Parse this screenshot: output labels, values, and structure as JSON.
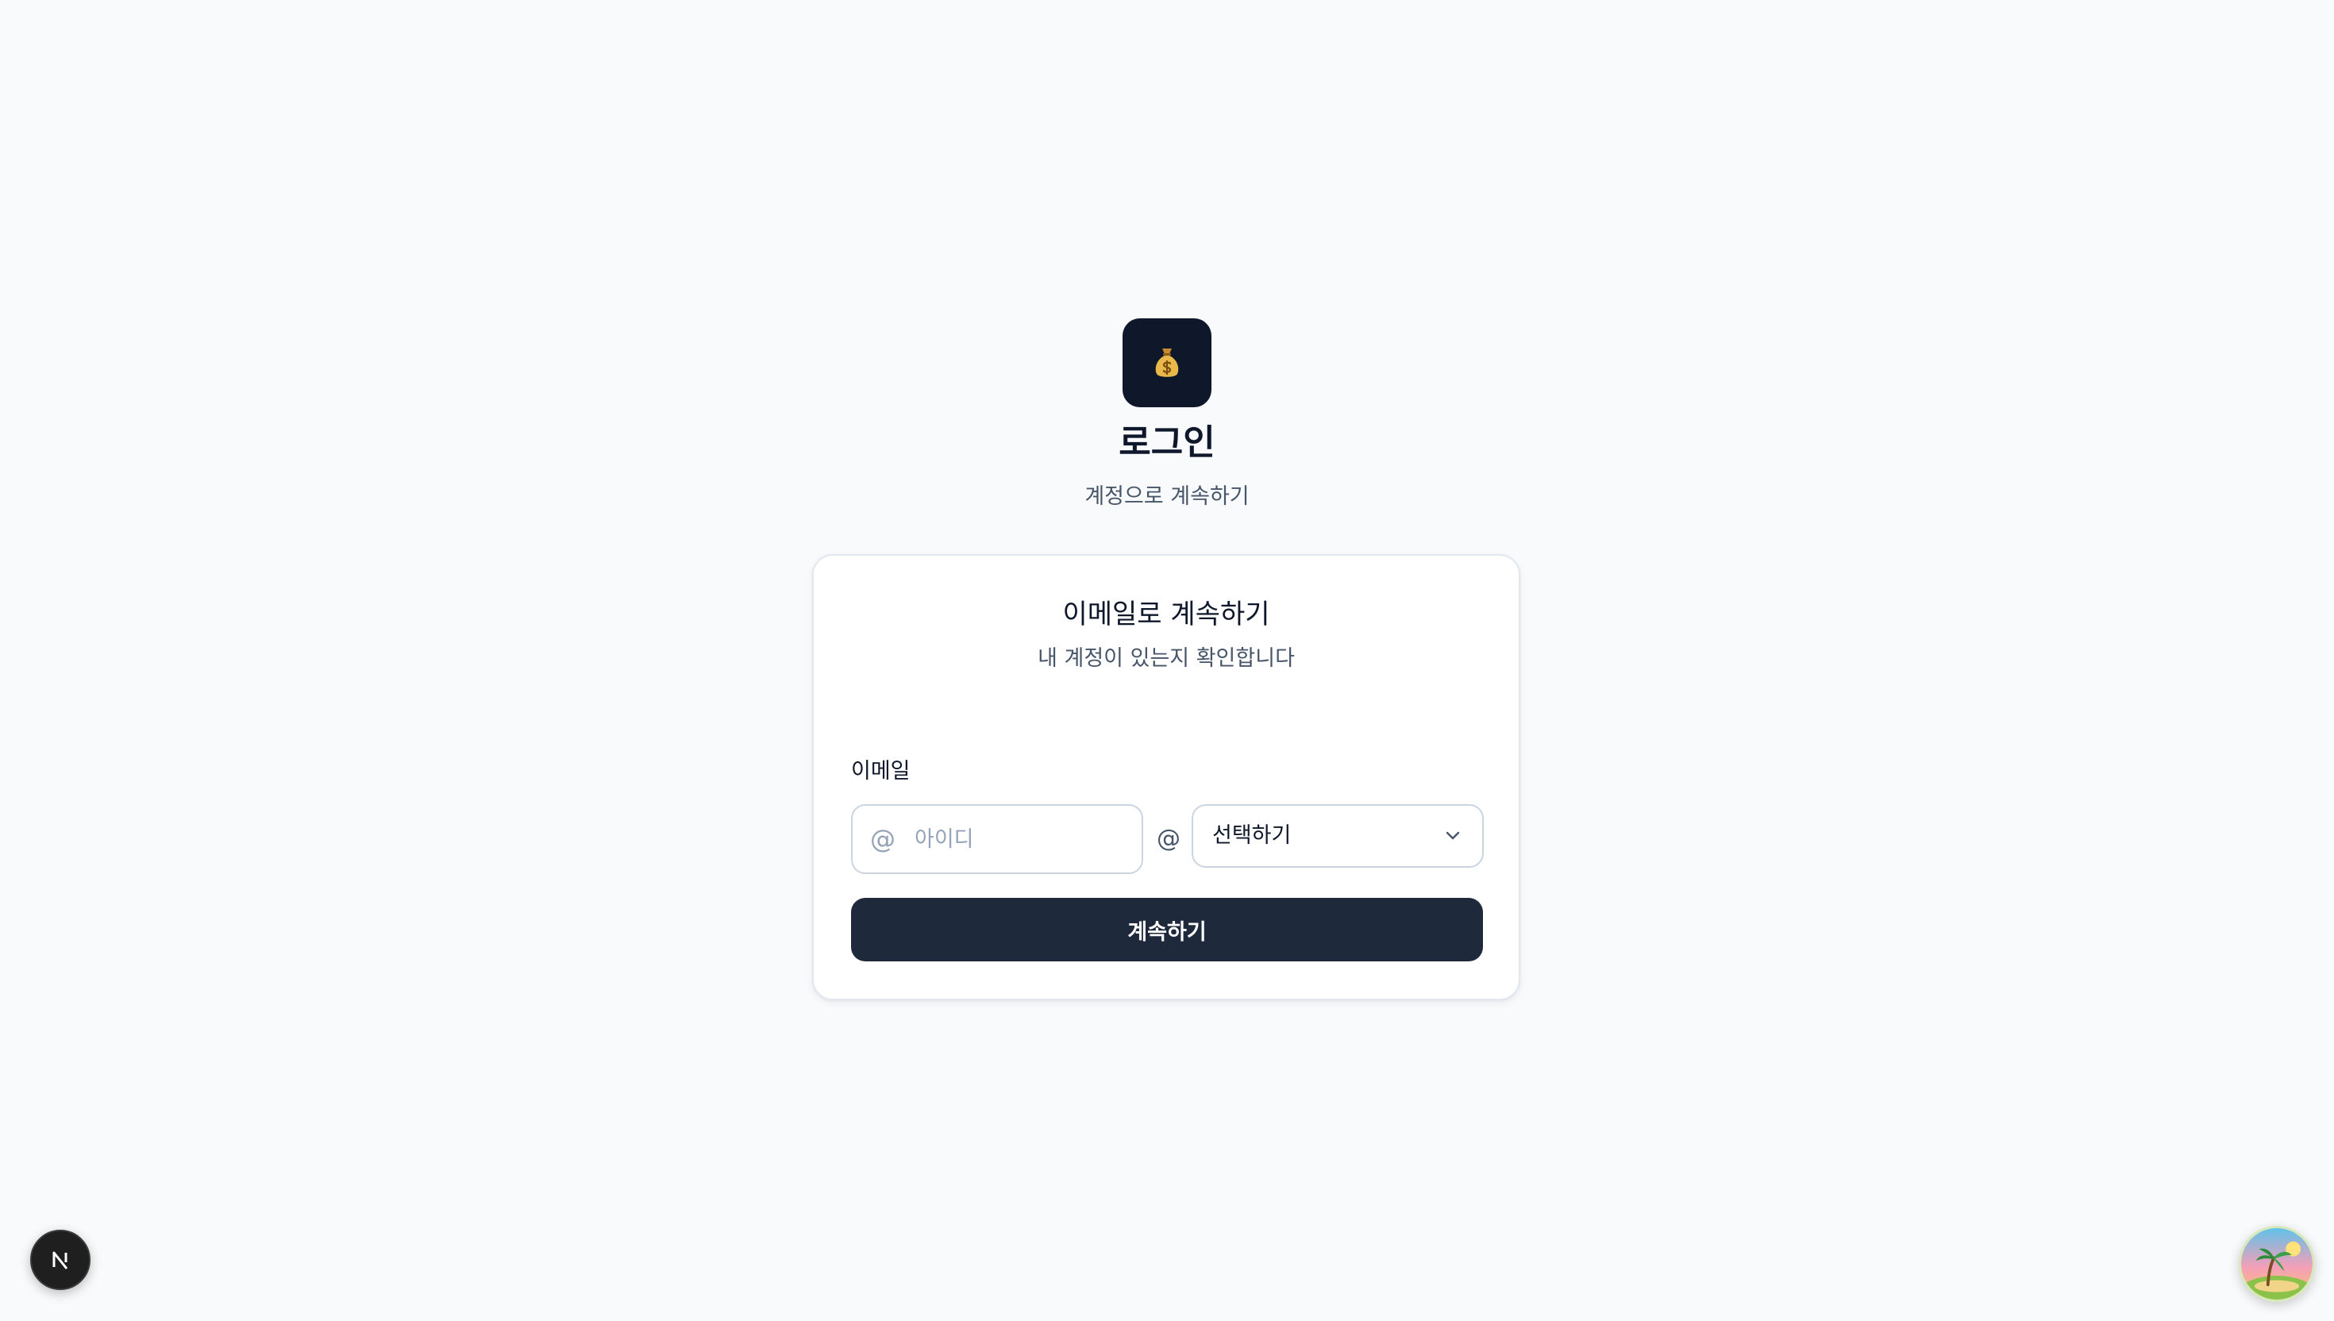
{
  "header": {
    "logo_icon": "money-bag-icon",
    "title": "로그인",
    "subtitle": "계정으로 계속하기"
  },
  "card": {
    "title": "이메일로 계속하기",
    "subtitle": "내 계정이 있는지 확인합니다",
    "email_label": "이메일",
    "id_field": {
      "icon": "at-sign-icon",
      "symbol": "@",
      "placeholder": "아이디",
      "value": ""
    },
    "at_separator": "@",
    "domain_select": {
      "selected": "선택하기",
      "icon": "chevron-down-icon"
    },
    "continue_label": "계속하기"
  },
  "widgets": {
    "dev_badge_icon": "nextjs-n-icon",
    "avatar_icon": "island-avatar-icon"
  },
  "colors": {
    "page_background": "#f8fafc",
    "logo_tile": "#0f172a",
    "primary_button": "#1e293b",
    "muted_text": "#475569",
    "placeholder": "#94a3b8",
    "border": "#cbd5e1"
  }
}
